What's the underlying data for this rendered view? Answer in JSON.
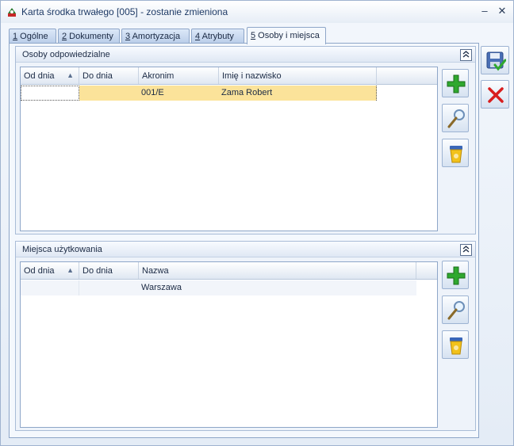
{
  "window": {
    "title": "Karta środka trwałego [005] - zostanie zmieniona",
    "minimize": "–",
    "close": "✕"
  },
  "tabs": [
    {
      "key": "1",
      "label": " Ogólne"
    },
    {
      "key": "2",
      "label": " Dokumenty"
    },
    {
      "key": "3",
      "label": " Amortyzacja"
    },
    {
      "key": "4",
      "label": " Atrybuty"
    },
    {
      "key": "5",
      "label": " Osoby i miejsca"
    }
  ],
  "persons": {
    "title": "Osoby odpowiedzialne",
    "collapse": "⌃",
    "columns": [
      "Od dnia",
      "Do dnia",
      "Akronim",
      "Imię i nazwisko"
    ],
    "sort_indicator": "▲",
    "rows": [
      {
        "od": "",
        "do": "",
        "akronim": "001/E",
        "imie": "Zama Robert"
      }
    ]
  },
  "places": {
    "title": "Miejsca użytkowania",
    "collapse": "⌃",
    "columns": [
      "Od dnia",
      "Do dnia",
      "Nazwa"
    ],
    "sort_indicator": "▲",
    "rows": [
      {
        "od": "",
        "do": "",
        "nazwa": "Warszawa"
      }
    ]
  },
  "icons": {
    "add": "plus-icon",
    "edit": "magnifier-icon",
    "delete": "trash-icon",
    "save": "save-icon",
    "cancel": "cancel-icon"
  },
  "colors": {
    "selected_row": "#fbe39a",
    "add_green": "#2fa82f",
    "cancel_red": "#d81e1e"
  }
}
